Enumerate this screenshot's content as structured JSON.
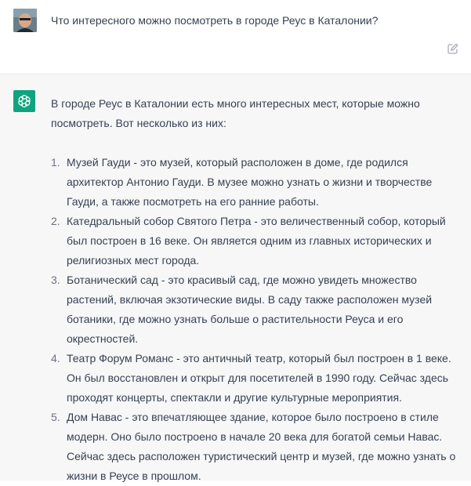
{
  "user_message": {
    "text": "Что интересного можно посмотреть в городе Реус в Каталонии?"
  },
  "assistant_message": {
    "intro": "В городе Реус в Каталонии есть много интересных мест, которые можно посмотреть. Вот несколько из них:",
    "items": [
      {
        "num": "1.",
        "text": "Музей Гауди - это музей, который расположен в доме, где родился архитектор Антонио Гауди. В музее можно узнать о жизни и творчестве Гауди, а также посмотреть на его ранние работы."
      },
      {
        "num": "2.",
        "text": "Катедральный собор Святого Петра - это величественный собор, который был построен в 16 веке. Он является одним из главных исторических и религиозных мест города."
      },
      {
        "num": "3.",
        "text": "Ботанический сад - это красивый сад, где можно увидеть множество растений, включая экзотические виды. В саду также расположен музей ботаники, где можно узнать больше о растительности Реуса и его окрестностей."
      },
      {
        "num": "4.",
        "text": "Театр Форум Романс - это античный театр, который был построен в 1 веке. Он был восстановлен и открыт для посетителей в 1990 году. Сейчас здесь проходят концерты, спектакли и другие культурные мероприятия."
      },
      {
        "num": "5.",
        "text": "Дом Навас - это впечатляющее здание, которое было построено в стиле модерн. Оно было построено в начале 20 века для богатой семьи Навас. Сейчас здесь расположен туристический центр и музей, где можно узнать о жизни в Реусе в прошлом."
      }
    ]
  },
  "icons": {
    "user_avatar": "user-avatar-photo",
    "edit": "edit-icon",
    "assistant_avatar": "openai-logo-icon"
  },
  "colors": {
    "assistant_bg": "#f7f7f8",
    "user_bg": "#ffffff",
    "brand_green": "#10a37f",
    "text": "#374151"
  }
}
